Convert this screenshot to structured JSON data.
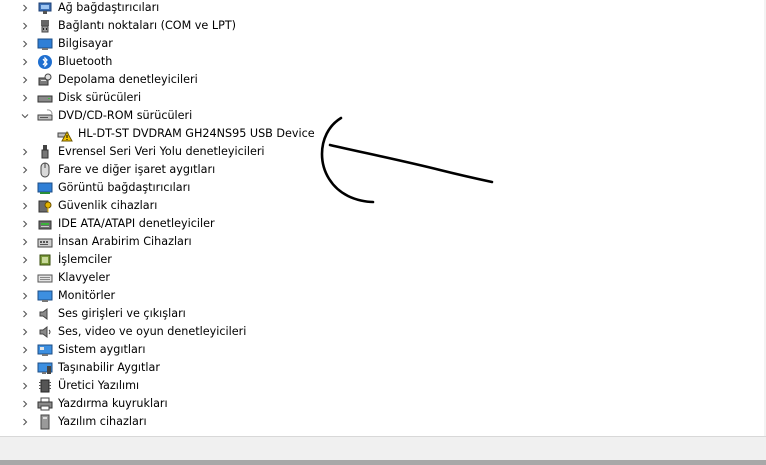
{
  "tree": {
    "categories": [
      {
        "label": "Ağ bağdaştırıcıları",
        "icon": "network-adapter-icon",
        "expanded": false
      },
      {
        "label": "Bağlantı noktaları (COM ve LPT)",
        "icon": "port-icon",
        "expanded": false
      },
      {
        "label": "Bilgisayar",
        "icon": "computer-icon",
        "expanded": false
      },
      {
        "label": "Bluetooth",
        "icon": "bluetooth-icon",
        "expanded": false
      },
      {
        "label": "Depolama denetleyicileri",
        "icon": "storage-controller-icon",
        "expanded": false
      },
      {
        "label": "Disk sürücüleri",
        "icon": "disk-drive-icon",
        "expanded": false
      },
      {
        "label": "DVD/CD-ROM sürücüleri",
        "icon": "dvd-drive-icon",
        "expanded": true
      },
      {
        "label": "HL-DT-ST DVDRAM GH24NS95 USB Device",
        "icon": "dvd-warning-icon",
        "child": true
      },
      {
        "label": "Evrensel Seri Veri Yolu denetleyicileri",
        "icon": "usb-icon",
        "expanded": false
      },
      {
        "label": "Fare ve diğer işaret aygıtları",
        "icon": "mouse-icon",
        "expanded": false
      },
      {
        "label": "Görüntü bağdaştırıcıları",
        "icon": "display-adapter-icon",
        "expanded": false
      },
      {
        "label": "Güvenlik cihazları",
        "icon": "security-device-icon",
        "expanded": false
      },
      {
        "label": "IDE ATA/ATAPI denetleyiciler",
        "icon": "ide-controller-icon",
        "expanded": false
      },
      {
        "label": "İnsan Arabirim Cihazları",
        "icon": "hid-icon",
        "expanded": false
      },
      {
        "label": "İşlemciler",
        "icon": "processor-icon",
        "expanded": false
      },
      {
        "label": "Klavyeler",
        "icon": "keyboard-icon",
        "expanded": false
      },
      {
        "label": "Monitörler",
        "icon": "monitor-icon",
        "expanded": false
      },
      {
        "label": "Ses girişleri ve çıkışları",
        "icon": "audio-io-icon",
        "expanded": false
      },
      {
        "label": "Ses, video ve oyun denetleyicileri",
        "icon": "sound-video-icon",
        "expanded": false
      },
      {
        "label": "Sistem aygıtları",
        "icon": "system-device-icon",
        "expanded": false
      },
      {
        "label": "Taşınabilir Aygıtlar",
        "icon": "portable-device-icon",
        "expanded": false
      },
      {
        "label": "Üretici Yazılımı",
        "icon": "firmware-icon",
        "expanded": false
      },
      {
        "label": "Yazdırma kuyrukları",
        "icon": "printer-icon",
        "expanded": false
      },
      {
        "label": "Yazılım cihazları",
        "icon": "software-device-icon",
        "expanded": false
      }
    ]
  },
  "colors": {
    "background": "#ffffff",
    "chevron": "#555555",
    "warning": "#f2c200",
    "annotation": "#000000"
  }
}
